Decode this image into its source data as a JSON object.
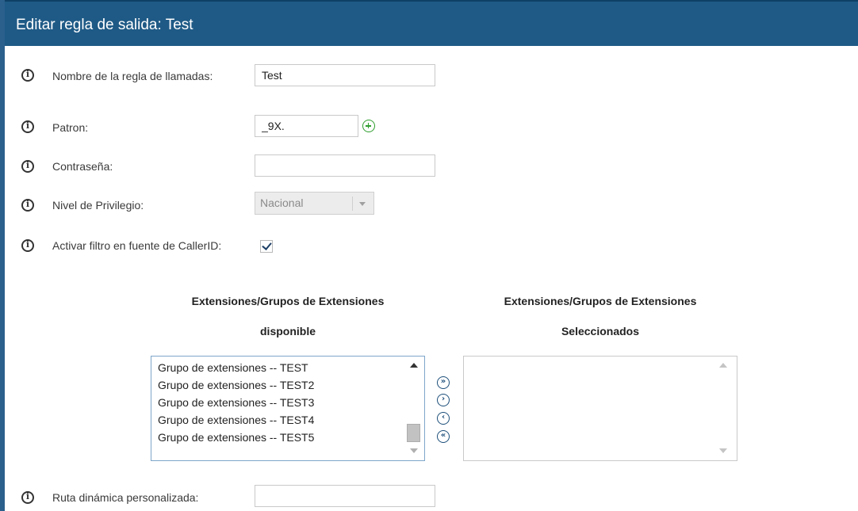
{
  "dialog": {
    "title": "Editar regla de salida: Test"
  },
  "fields": {
    "rule_name": {
      "label": "Nombre de la regla de llamadas:",
      "value": "Test"
    },
    "pattern": {
      "label": "Patron:",
      "value": "_9X."
    },
    "password": {
      "label": "Contraseña:",
      "value": ""
    },
    "privilege": {
      "label": "Nivel de Privilegio:",
      "value": "Nacional"
    },
    "callerid_filter": {
      "label": "Activar filtro en fuente de CallerID:",
      "checked": true
    },
    "dynamic_route": {
      "label": "Ruta dinámica personalizada:",
      "value": ""
    }
  },
  "available": {
    "heading1": "Extensiones/Grupos de Extensiones",
    "heading2": "disponible",
    "items": [
      "Grupo de extensiones -- TEST",
      "Grupo de extensiones -- TEST2",
      "Grupo de extensiones -- TEST3",
      "Grupo de extensiones -- TEST4",
      "Grupo de extensiones -- TEST5"
    ]
  },
  "selected": {
    "heading1": "Extensiones/Grupos de Extensiones",
    "heading2": "Seleccionados",
    "items": []
  },
  "move_buttons": {
    "add_all": "»",
    "add_one": "›",
    "remove_one": "‹",
    "remove_all": "«"
  },
  "colors": {
    "title_bar": "#1f5a86",
    "add_icon": "#2e9e2e",
    "accent": "#1d4f7a"
  }
}
